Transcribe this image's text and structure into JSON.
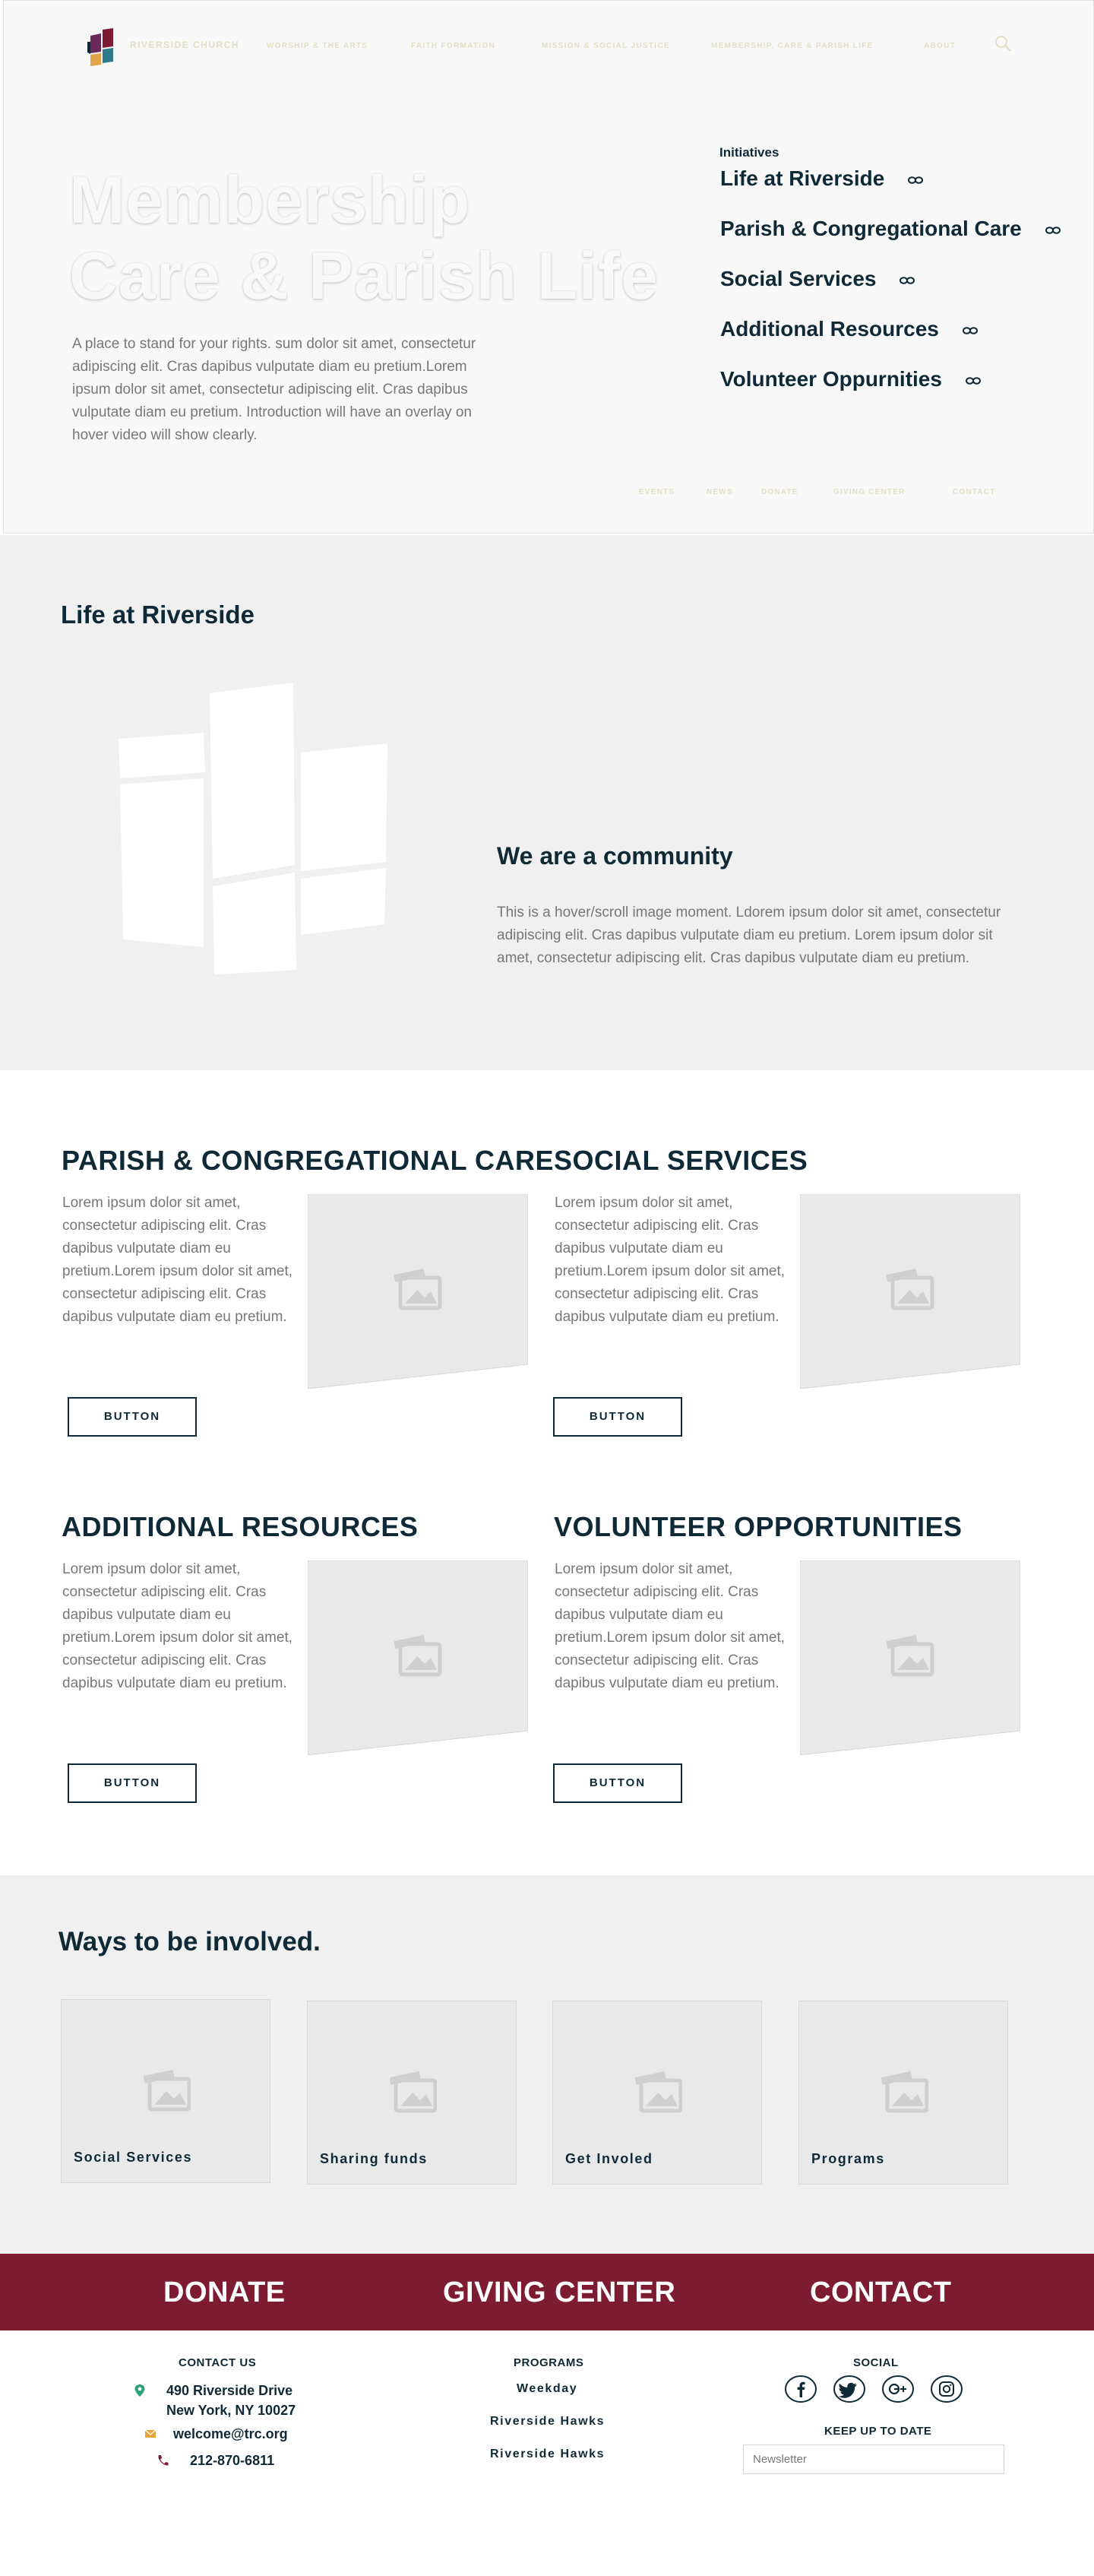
{
  "header": {
    "brand": "RIVERSIDE CHURCH",
    "nav": [
      "WORSHIP & THE ARTS",
      "FAITH FORMATION",
      "MISSION & SOCIAL JUSTICE",
      "MEMBERSHIP, CARE & PARISH LIFE",
      "ABOUT"
    ],
    "search_icon": "search-icon"
  },
  "hero": {
    "title_line1": "Membership",
    "title_line2": "Care & Parish Life",
    "intro": "A place to stand for your rights. sum dolor sit amet, consectetur adipiscing elit. Cras dapibus vulputate diam eu pretium.Lorem ipsum dolor sit amet, consectetur adipiscing elit. Cras dapibus vulputate diam eu pretium. Introduction will have an overlay on hover video will show clearly.",
    "initiatives_heading": "Initiatives",
    "initiatives": [
      "Life at Riverside",
      "Parish & Congregational Care",
      "Social Services",
      "Additional Resources",
      "Volunteer Oppurnities"
    ],
    "link_icon": "link-icon",
    "sub_nav": [
      "EVENTS",
      "NEWS",
      "DONATE",
      "GIVING CENTER",
      "CONTACT"
    ]
  },
  "life": {
    "title": "Life at Riverside",
    "community_title": "We are a community",
    "community_text": "This is a hover/scroll image moment. Ldorem ipsum dolor sit amet, consectetur adipiscing elit. Cras dapibus vulputate diam eu pretium. Lorem ipsum dolor sit amet, consectetur adipiscing elit. Cras dapibus vulputate diam eu pretium."
  },
  "cards": [
    {
      "title": "PARISH & CONGREGATIONAL CARE",
      "text": "Lorem ipsum dolor sit amet, consectetur adipiscing elit. Cras dapibus vulputate diam eu pretium.Lorem ipsum dolor sit amet, consectetur adipiscing elit. Cras dapibus vulputate diam eu pretium.",
      "button": "BUTTON"
    },
    {
      "title": "SOCIAL SERVICES",
      "text": "Lorem ipsum dolor sit amet, consectetur adipiscing elit. Cras dapibus vulputate diam eu pretium.Lorem ipsum dolor sit amet, consectetur adipiscing elit. Cras dapibus vulputate diam eu pretium.",
      "button": "BUTTON"
    },
    {
      "title": "ADDITIONAL RESOURCES",
      "text": "Lorem ipsum dolor sit amet, consectetur adipiscing elit. Cras dapibus vulputate diam eu pretium.Lorem ipsum dolor sit amet, consectetur adipiscing elit. Cras dapibus vulputate diam eu pretium.",
      "button": "BUTTON"
    },
    {
      "title": "VOLUNTEER OPPORTUNITIES",
      "text": "Lorem ipsum dolor sit amet, consectetur adipiscing elit. Cras dapibus vulputate diam eu pretium.Lorem ipsum dolor sit amet, consectetur adipiscing elit. Cras dapibus vulputate diam eu pretium.",
      "button": "BUTTON"
    }
  ],
  "ways": {
    "title": "Ways to be involved.",
    "tiles": [
      "Social Services",
      "Sharing funds",
      "Get Involed",
      "Programs"
    ]
  },
  "band": [
    "DONATE",
    "GIVING CENTER",
    "CONTACT"
  ],
  "footer": {
    "contact_heading": "CONTACT US",
    "address_line1": "490 Riverside Drive",
    "address_line2": "New York, NY 10027",
    "email": "welcome@trc.org",
    "phone": "212-870-6811",
    "programs_heading": "PROGRAMS",
    "programs": [
      "Weekday",
      "Riverside Hawks",
      "Riverside Hawks"
    ],
    "social_heading": "SOCIAL",
    "social_icons": [
      "facebook-icon",
      "twitter-icon",
      "google-plus-icon",
      "instagram-icon"
    ],
    "keep_up_heading": "KEEP UP TO DATE",
    "newsletter_placeholder": "Newsletter"
  },
  "colors": {
    "navy": "#0f2a36",
    "accent_red": "#7d1c31",
    "nav_tan": "#e3dfc6",
    "logo_purple": "#6b2a5a",
    "logo_orange": "#e2a349",
    "logo_teal": "#2e7a8a",
    "map_pin_green": "#2aa27a",
    "mail_orange": "#e8a33c",
    "phone_maroon": "#7d1c31"
  }
}
